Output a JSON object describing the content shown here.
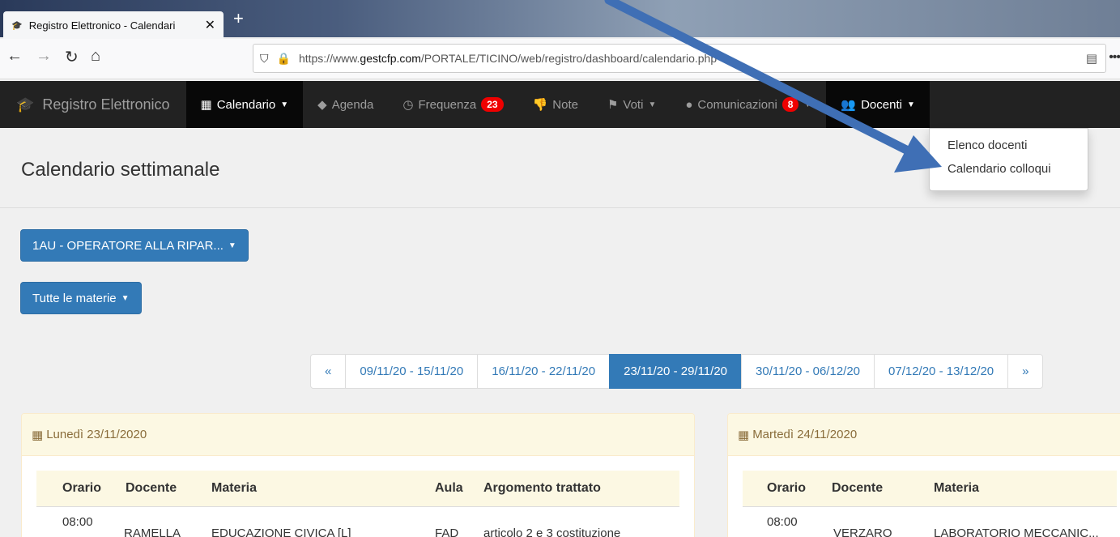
{
  "browser": {
    "tab_title": "Registro Elettronico - Calendari",
    "url_prefix": "https://www.",
    "url_domain": "gestcfp.com",
    "url_path": "/PORTALE/TICINO/web/registro/dashboard/calendario.php"
  },
  "appnav": {
    "brand": "Registro Elettronico",
    "items": [
      {
        "label": "Calendario",
        "icon": "calendar-icon"
      },
      {
        "label": "Agenda",
        "icon": "tags-icon"
      },
      {
        "label": "Frequenza",
        "icon": "clock-icon",
        "badge": "23"
      },
      {
        "label": "Note",
        "icon": "thumbs-down-icon"
      },
      {
        "label": "Voti",
        "icon": "flag-icon"
      },
      {
        "label": "Comunicazioni",
        "icon": "comment-icon",
        "badge": "8"
      },
      {
        "label": "Docenti",
        "icon": "users-icon"
      }
    ],
    "dropdown": [
      "Elenco docenti",
      "Calendario colloqui"
    ]
  },
  "page": {
    "title": "Calendario settimanale",
    "class_button": "1AU - OPERATORE ALLA RIPAR...",
    "subject_button": "Tutte le materie"
  },
  "pagination": {
    "prev": "«",
    "weeks": [
      "09/11/20 - 15/11/20",
      "16/11/20 - 22/11/20",
      "23/11/20 - 29/11/20",
      "30/11/20 - 06/12/20",
      "07/12/20 - 13/12/20"
    ],
    "next": "»",
    "active_index": 2
  },
  "panels": [
    {
      "day": "Lunedì 23/11/2020",
      "headers": [
        "Orario",
        "Docente",
        "Materia",
        "Aula",
        "Argomento trattato"
      ],
      "row": {
        "orario": "08:00",
        "docente": "RAMELLA",
        "materia": "EDUCAZIONE CIVICA [L]",
        "aula": "FAD",
        "argomento": "articolo 2 e 3 costituzione"
      }
    },
    {
      "day": "Martedì 24/11/2020",
      "headers": [
        "Orario",
        "Docente",
        "Materia"
      ],
      "row": {
        "orario": "08:00",
        "docente": "VERZARO",
        "materia": "LABORATORIO MECCANIC..."
      }
    }
  ],
  "colors": {
    "primary": "#337ab7",
    "navbar": "#222222",
    "badge": "#ee0000",
    "panel_head": "#fcf8e3",
    "arrow": "#3f6fb5"
  }
}
